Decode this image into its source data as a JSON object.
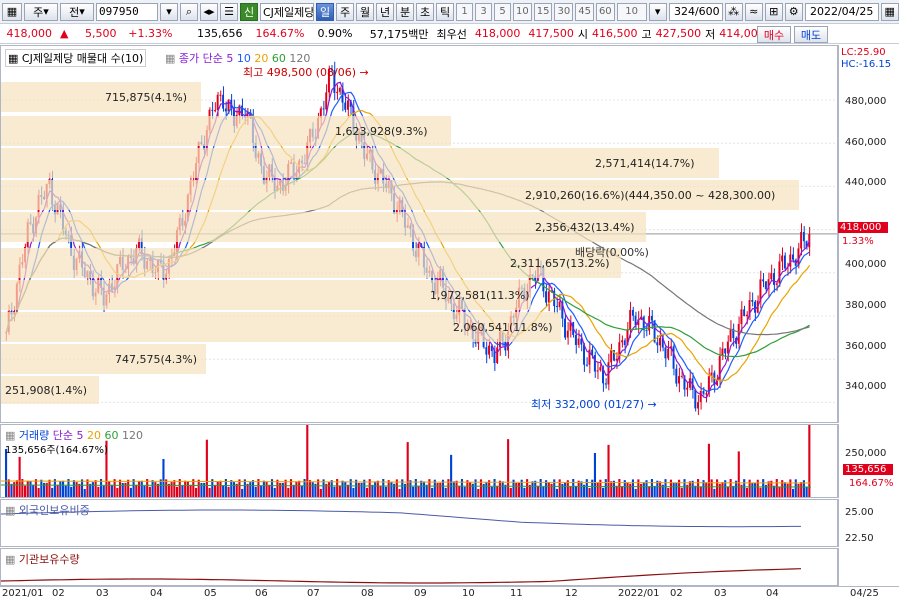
{
  "toolbar": {
    "type_label": "주",
    "prev_label": "전",
    "code": "097950",
    "name_icon": "sin",
    "stock_name": "CJ제일제당",
    "periods": [
      "일",
      "주",
      "월",
      "년",
      "분",
      "초",
      "틱"
    ],
    "intervals": [
      "1",
      "3",
      "5",
      "10",
      "15",
      "30",
      "45",
      "60",
      "10"
    ],
    "count": "324/600",
    "date": "2022/04/25"
  },
  "quote": {
    "price": "418,000",
    "change": "5,500",
    "rate": "+1.33%",
    "volume": "135,656",
    "vol_rate": "164.67%",
    "turnover": "0.90%",
    "amount": "57,175백만",
    "bid_label": "최우선",
    "bid1": "418,000",
    "bid2": "417,500",
    "open_label": "시",
    "open": "416,500",
    "high_label": "고",
    "high": "427,500",
    "low_label": "저",
    "low": "414,000",
    "buy": "매수",
    "sell": "매도"
  },
  "chart": {
    "title": "CJ제일제당 매물대 수(10)",
    "ma_label": "종가 단순",
    "ma_periods": [
      "5",
      "10",
      "20",
      "60",
      "120"
    ],
    "lc": "LC:25.90",
    "hc": "HC:-16.15",
    "high_label": "최고 498,500 (08/06)",
    "low_label": "최저 332,000 (01/27)",
    "div_label": "배당락(0.00%)",
    "current_price": "418,000",
    "current_rate": "1.33%",
    "y_ticks": [
      "480,000",
      "460,000",
      "440,000",
      "420,000",
      "400,000",
      "380,000",
      "360,000",
      "340,000"
    ],
    "profile": [
      {
        "label": "715,875(4.1%)"
      },
      {
        "label": "1,623,928(9.3%)"
      },
      {
        "label": "2,571,414(14.7%)"
      },
      {
        "label": "2,910,260(16.6%)(444,350.00 ~ 428,300.00)"
      },
      {
        "label": "2,356,432(13.4%)"
      },
      {
        "label": "2,311,657(13.2%)"
      },
      {
        "label": "1,972,581(11.3%)"
      },
      {
        "label": "2,060,541(11.8%)"
      },
      {
        "label": "747,575(4.3%)"
      },
      {
        "label": "251,908(1.4%)"
      }
    ],
    "x_ticks": [
      "2021/01",
      "02",
      "03",
      "04",
      "05",
      "06",
      "07",
      "08",
      "09",
      "10",
      "11",
      "12",
      "2022/01",
      "02",
      "03",
      "04"
    ],
    "x_right": "04/25"
  },
  "volume": {
    "title": "거래량",
    "ma_label": "단순",
    "ma_periods": [
      "5",
      "20",
      "60",
      "120"
    ],
    "value_label": "135,656주(164.67%)",
    "y_tick": "250,000",
    "current": "135,656",
    "rate": "164.67%"
  },
  "foreign": {
    "title": "외국인보유비중",
    "ticks": [
      "25.00",
      "22.50"
    ]
  },
  "inst": {
    "title": "기관보유수량"
  },
  "colors": {
    "up": "#e0001c",
    "down": "#0042d6",
    "ma5": "#8a1bd6",
    "ma10": "#1a5cff",
    "ma20": "#e8a400",
    "ma60": "#2f9e3a",
    "ma120": "#777777",
    "profile": "#f6e2be"
  },
  "chart_data": {
    "type": "candlestick",
    "note_series": "daily prices",
    "ylim": [
      330000,
      505000
    ],
    "closes": [
      370000,
      395000,
      418000,
      432000,
      440000,
      425000,
      410000,
      402000,
      395000,
      388000,
      398000,
      405000,
      410000,
      406000,
      400000,
      404000,
      420000,
      440000,
      460000,
      475000,
      482000,
      470000,
      478000,
      455000,
      445000,
      440000,
      445000,
      450000,
      460000,
      475000,
      492000,
      480000,
      470000,
      455000,
      448000,
      440000,
      432000,
      420000,
      410000,
      398000,
      395000,
      385000,
      380000,
      372000,
      368000,
      362000,
      370000,
      385000,
      395000,
      400000,
      390000,
      382000,
      372000,
      365000,
      358000,
      352000,
      360000,
      372000,
      380000,
      376000,
      370000,
      362000,
      352000,
      345000,
      342000,
      350000,
      362000,
      372000,
      380000,
      388000,
      395000,
      400000,
      405000,
      410000,
      418000
    ]
  }
}
